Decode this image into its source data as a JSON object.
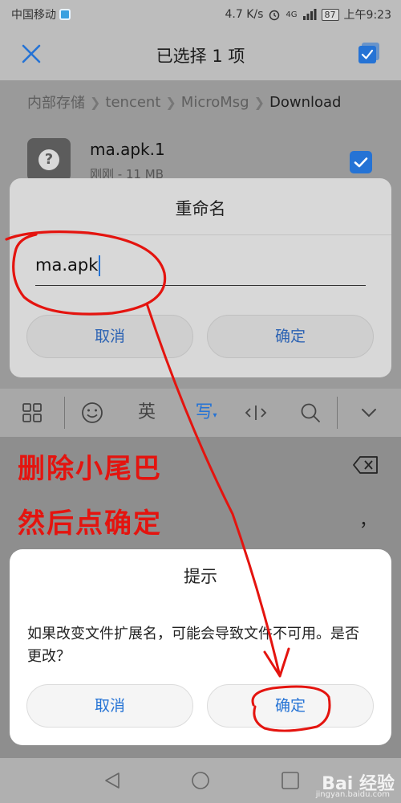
{
  "status_bar": {
    "carrier": "中国移动",
    "speed": "4.7 K/s",
    "network": "4G",
    "battery": "87",
    "time": "上午9:23"
  },
  "header": {
    "title": "已选择 1 项"
  },
  "breadcrumb": {
    "items": [
      "内部存储",
      "tencent",
      "MicroMsg"
    ],
    "current": "Download"
  },
  "file": {
    "name": "ma.apk.1",
    "meta": "刚刚 - 11 MB",
    "icon_glyph": "?"
  },
  "rename_dialog": {
    "title": "重命名",
    "input_value": "ma.apk",
    "cancel_label": "取消",
    "confirm_label": "确定"
  },
  "keyboard": {
    "lang_label": "英",
    "write_label": "写",
    "comma": "，"
  },
  "annotation": {
    "line1": "删除小尾巴",
    "line2": "然后点确定",
    "color": "#e4140f"
  },
  "prompt_dialog": {
    "title": "提示",
    "message": "如果改变文件扩展名，可能会导致文件不可用。是否更改？",
    "cancel_label": "取消",
    "confirm_label": "确定"
  },
  "watermark": {
    "brand": "Bai 经验",
    "site": "jingyan.baidu.com"
  },
  "colors": {
    "accent": "#2573d5"
  }
}
